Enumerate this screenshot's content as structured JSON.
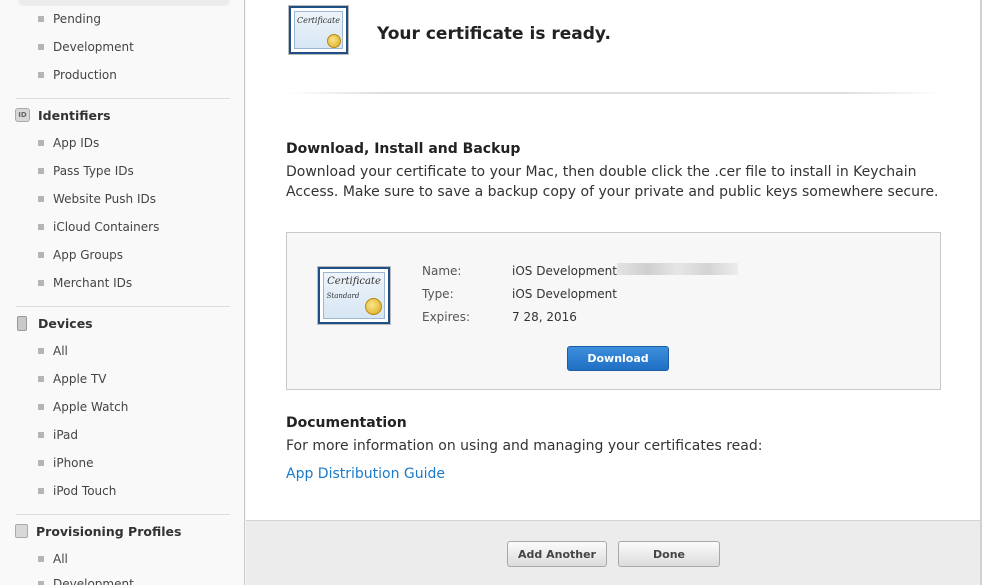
{
  "sidebar": {
    "certificates_items": [
      {
        "label": "Pending"
      },
      {
        "label": "Development"
      },
      {
        "label": "Production"
      }
    ],
    "identifiers": {
      "title": "Identifiers",
      "icon": "id-icon",
      "icon_text": "ID",
      "items": [
        {
          "label": "App IDs"
        },
        {
          "label": "Pass Type IDs"
        },
        {
          "label": "Website Push IDs"
        },
        {
          "label": "iCloud Containers"
        },
        {
          "label": "App Groups"
        },
        {
          "label": "Merchant IDs"
        }
      ]
    },
    "devices": {
      "title": "Devices",
      "icon": "device-icon",
      "items": [
        {
          "label": "All"
        },
        {
          "label": "Apple TV"
        },
        {
          "label": "Apple Watch"
        },
        {
          "label": "iPad"
        },
        {
          "label": "iPhone"
        },
        {
          "label": "iPod Touch"
        }
      ]
    },
    "provisioning": {
      "title": "Provisioning Profiles",
      "icon": "provisioning-icon",
      "items": [
        {
          "label": "All"
        },
        {
          "label": "Development"
        }
      ]
    }
  },
  "main": {
    "header_cert_icon_text": "Certificate",
    "title": "Your certificate is ready.",
    "download_section": {
      "heading": "Download, Install and Backup",
      "line1": "Download your certificate to your Mac, then double click the .cer file to install in Keychain",
      "line2": "Access. Make sure to save a backup copy of your private and public keys somewhere secure."
    },
    "certificate": {
      "icon_text": "Certificate",
      "icon_subtext": "Standard",
      "name_label": "Name:",
      "name_value": "iOS Development:",
      "type_label": "Type:",
      "type_value": "iOS Development",
      "expires_label": "Expires:",
      "expires_value": "7 28, 2016",
      "download_button": "Download"
    },
    "documentation": {
      "heading": "Documentation",
      "text": "For more information on using and managing your certificates read:",
      "link": "App Distribution Guide"
    }
  },
  "footer": {
    "add_another": "Add Another",
    "done": "Done"
  },
  "colors": {
    "accent": "#1b7ac9",
    "button_blue": "#2a7fd2"
  }
}
